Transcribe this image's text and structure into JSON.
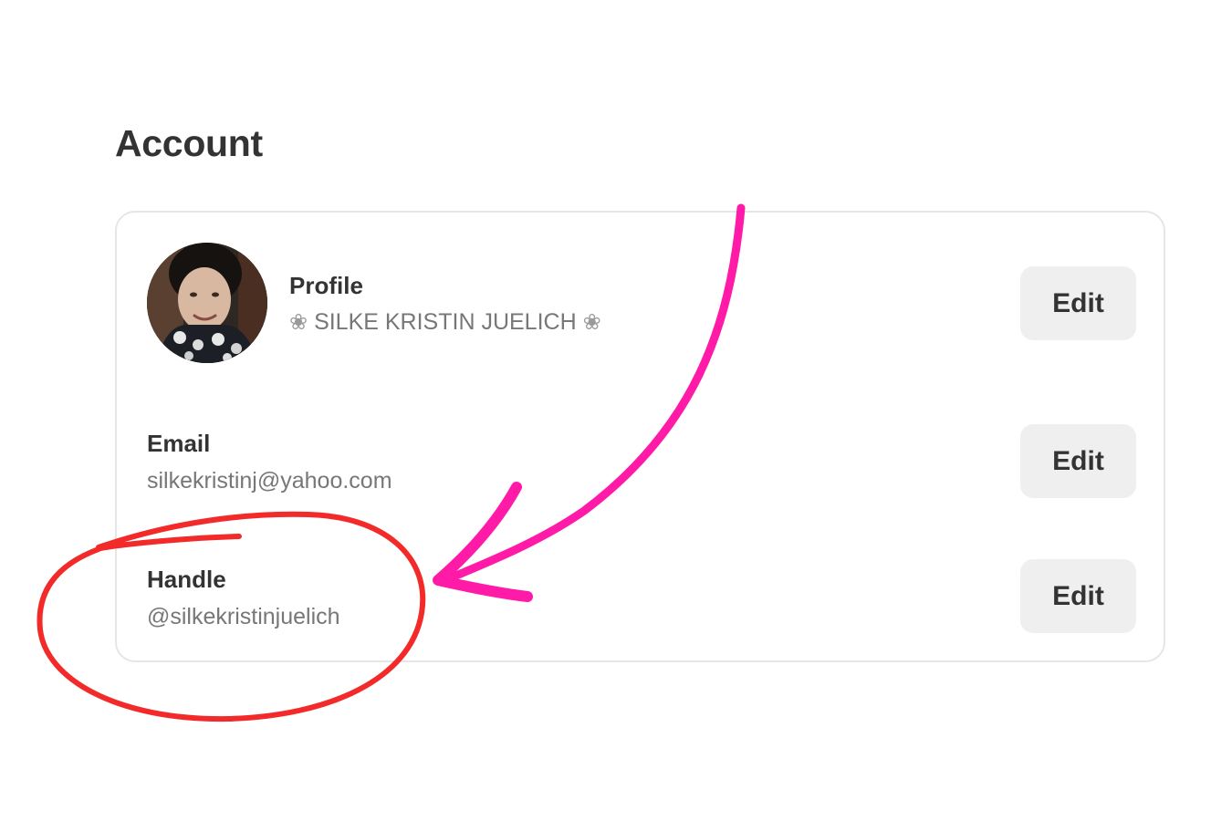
{
  "page": {
    "title": "Account"
  },
  "profile": {
    "label": "Profile",
    "flower_left": "❀",
    "name": "SILKE KRISTIN JUELICH",
    "flower_right": "❀",
    "edit_label": "Edit"
  },
  "email": {
    "label": "Email",
    "value": "silkekristinj@yahoo.com",
    "edit_label": "Edit"
  },
  "handle": {
    "label": "Handle",
    "value": "@silkekristinjuelich",
    "edit_label": "Edit"
  },
  "annotations": {
    "arrow_color": "#ff1aa8",
    "circle_color": "#f22a2a"
  },
  "colors": {
    "background": "#ffffff",
    "card_border": "#e6e6e6",
    "button_bg": "#efefef",
    "label_text": "#333333",
    "value_text": "#777777"
  }
}
